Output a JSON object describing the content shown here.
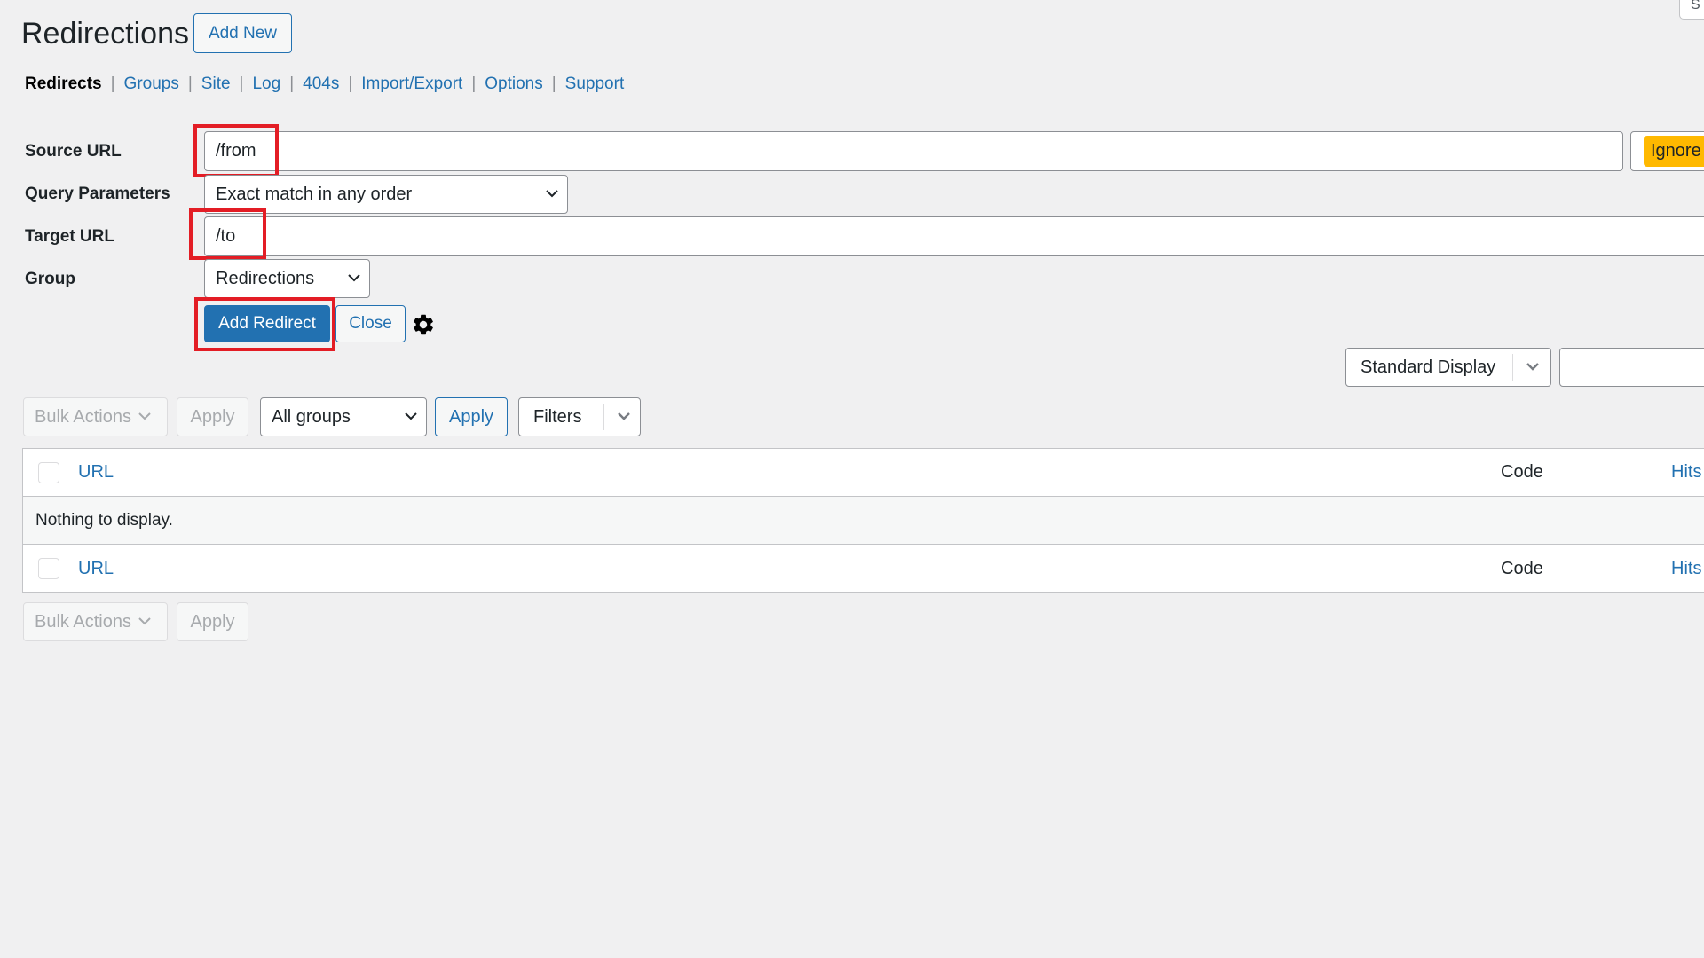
{
  "screen_options": {
    "label": "S"
  },
  "header": {
    "title": "Redirections",
    "add_new_label": "Add New"
  },
  "subnav": {
    "items": [
      {
        "label": "Redirects",
        "current": true
      },
      {
        "label": "Groups"
      },
      {
        "label": "Site"
      },
      {
        "label": "Log"
      },
      {
        "label": "404s"
      },
      {
        "label": "Import/Export"
      },
      {
        "label": "Options"
      },
      {
        "label": "Support"
      }
    ],
    "separator": "|"
  },
  "form": {
    "source_url": {
      "label": "Source URL",
      "value": "/from"
    },
    "ignore_label": "Ignore",
    "query_parameters": {
      "label": "Query Parameters",
      "value": "Exact match in any order"
    },
    "target_url": {
      "label": "Target URL",
      "value": "/to"
    },
    "group": {
      "label": "Group",
      "value": "Redirections"
    },
    "add_redirect_label": "Add Redirect",
    "close_label": "Close",
    "settings_icon": "gear-icon"
  },
  "display": {
    "mode": "Standard Display",
    "search_value": ""
  },
  "toolbar_top": {
    "bulk_actions": "Bulk Actions",
    "apply_disabled": "Apply",
    "group_filter": "All groups",
    "apply": "Apply",
    "filters": "Filters"
  },
  "table": {
    "columns": [
      "URL",
      "Code",
      "Hits"
    ],
    "empty_message": "Nothing to display."
  },
  "toolbar_bottom": {
    "bulk_actions": "Bulk Actions",
    "apply_disabled": "Apply"
  },
  "colors": {
    "accent": "#2271b1",
    "highlight": "#e31d25",
    "ignore_badge": "#ffb900",
    "background": "#f0f0f1"
  }
}
